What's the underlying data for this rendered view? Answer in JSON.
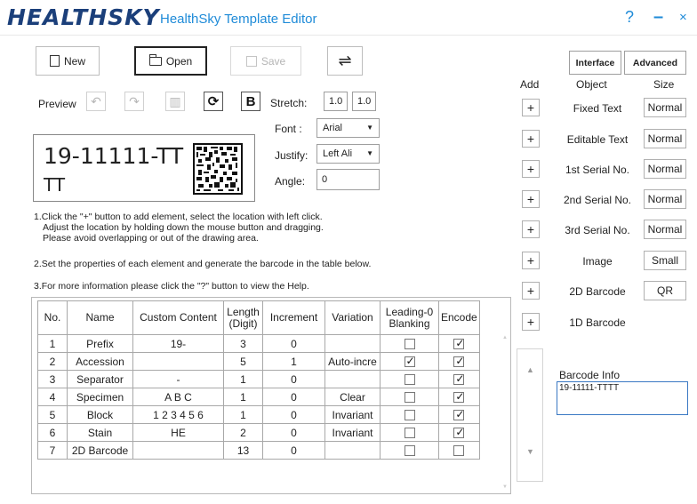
{
  "titlebar": {
    "logo": "HEALTHSKY",
    "title": "HealthSky Template Editor",
    "help": "?",
    "minimize": "–",
    "close": "×"
  },
  "toolbar": {
    "new_label": "New",
    "open_label": "Open",
    "save_label": "Save",
    "swap_icon": "⇌"
  },
  "preview": {
    "label": "Preview",
    "bold_label": "B",
    "stretch_label": "Stretch:",
    "stretch_x": "1.0",
    "stretch_y": "1.0",
    "font_label": "Font :",
    "font_value": "Arial",
    "justify_label": "Justify:",
    "justify_value": "Left Ali",
    "angle_label": "Angle:",
    "angle_value": "0",
    "canvas_line1": "19-11111-TT",
    "canvas_line2": "TT"
  },
  "instructions": {
    "line1": "1.Click the \"+\" button to add element, select the location with left click.",
    "line2": "Adjust the location by holding down the mouse button and dragging.",
    "line3": "Please avoid overlapping or out of the drawing area.",
    "line4": "2.Set the properties of each element and generate the barcode in the table below.",
    "line5": "3.For more information please click the \"?\" button to view the Help."
  },
  "table": {
    "headers": {
      "no": "No.",
      "name": "Name",
      "custom": "Custom Content",
      "length": "Length (Digit)",
      "increment": "Increment",
      "variation": "Variation",
      "leading": "Leading-0 Blanking",
      "encode": "Encode"
    },
    "rows": [
      {
        "no": "1",
        "name": "Prefix",
        "custom": "19-",
        "length": "3",
        "increment": "0",
        "variation": "",
        "leading": false,
        "encode": true
      },
      {
        "no": "2",
        "name": "Accession",
        "custom": "",
        "length": "5",
        "increment": "1",
        "variation": "Auto-incre",
        "leading": true,
        "encode": true
      },
      {
        "no": "3",
        "name": "Separator",
        "custom": "-",
        "length": "1",
        "increment": "0",
        "variation": "",
        "leading": false,
        "encode": true
      },
      {
        "no": "4",
        "name": "Specimen",
        "custom": "A B C",
        "length": "1",
        "increment": "0",
        "variation": "Clear",
        "leading": false,
        "encode": true
      },
      {
        "no": "5",
        "name": "Block",
        "custom": "1 2 3 4 5 6",
        "length": "1",
        "increment": "0",
        "variation": "Invariant",
        "leading": false,
        "encode": true
      },
      {
        "no": "6",
        "name": "Stain",
        "custom": "HE",
        "length": "2",
        "increment": "0",
        "variation": "Invariant",
        "leading": false,
        "encode": true
      },
      {
        "no": "7",
        "name": "2D Barcode",
        "custom": "",
        "length": "13",
        "increment": "0",
        "variation": "",
        "leading": false,
        "encode": false
      }
    ]
  },
  "right_panel": {
    "interface_label": "Interface",
    "advanced_label": "Advanced",
    "add_header": "Add",
    "object_header": "Object",
    "size_header": "Size",
    "objects": [
      {
        "name": "Fixed Text",
        "size": "Normal"
      },
      {
        "name": "Editable Text",
        "size": "Normal"
      },
      {
        "name": "1st Serial No.",
        "size": "Normal"
      },
      {
        "name": "2nd Serial No.",
        "size": "Normal"
      },
      {
        "name": "3rd Serial No.",
        "size": "Normal"
      },
      {
        "name": "Image",
        "size": "Small"
      },
      {
        "name": "2D Barcode",
        "size": "QR"
      },
      {
        "name": "1D Barcode",
        "size": ""
      }
    ],
    "plus": "+",
    "barcode_info_label": "Barcode Info",
    "barcode_info_value": "19-11111-TTTT"
  }
}
